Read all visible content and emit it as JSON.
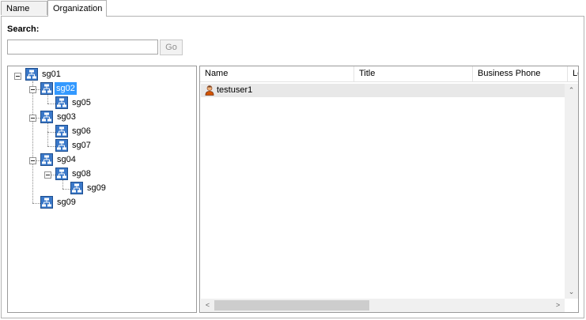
{
  "tabs": [
    {
      "label": "Name List"
    },
    {
      "label": "Organization"
    }
  ],
  "search": {
    "label": "Search:",
    "value": "",
    "button": "Go"
  },
  "tree": {
    "nodes": [
      {
        "label": "sg01"
      },
      {
        "label": "sg02"
      },
      {
        "label": "sg05"
      },
      {
        "label": "sg03"
      },
      {
        "label": "sg06"
      },
      {
        "label": "sg07"
      },
      {
        "label": "sg04"
      },
      {
        "label": "sg08"
      },
      {
        "label": "sg09"
      },
      {
        "label": "sg09"
      }
    ],
    "selected_index": 1
  },
  "list": {
    "columns": [
      "Name",
      "Title",
      "Business Phone",
      "Lo"
    ],
    "rows": [
      {
        "name": "testuser1"
      }
    ]
  },
  "colors": {
    "selection": "#3399ff",
    "row_highlight": "#e8e8e8"
  }
}
